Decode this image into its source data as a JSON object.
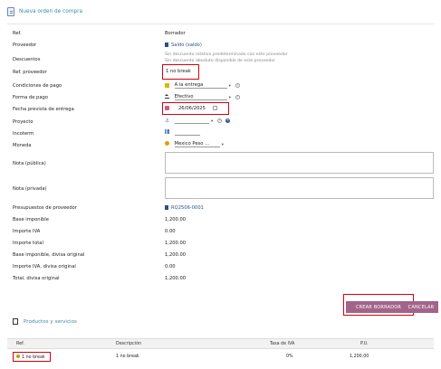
{
  "header": {
    "title": "Nueva orden de compra"
  },
  "form": {
    "ref": {
      "label": "Ref.",
      "value": "Borrador"
    },
    "proveedor": {
      "label": "Proveedor",
      "value": "Saldo (saldo)"
    },
    "descuentos": {
      "label": "Descuentos",
      "hint1": "Sin descuento relativo predeterminado con este proveedor",
      "hint2": "Sin descuento absoluto disponible de este proveedor"
    },
    "ref_proveedor": {
      "label": "Ref. proveedor",
      "value": "1 no break"
    },
    "condiciones": {
      "label": "Condiciones de pago",
      "value": "A la entrega"
    },
    "forma_pago": {
      "label": "Forma de pago",
      "value": "Efectivo"
    },
    "fecha": {
      "label": "Fecha prevista de entrega",
      "value": "26/06/2025"
    },
    "proyecto": {
      "label": "Proyecto",
      "value": ""
    },
    "incoterm": {
      "label": "Incoterm",
      "value": ""
    },
    "moneda": {
      "label": "Moneda",
      "value": "Mexico Peso ..."
    },
    "nota_publica": {
      "label": "Nota (pública)"
    },
    "nota_privada": {
      "label": "Nota (privada)"
    },
    "presupuestos": {
      "label": "Presupuestos de proveedor",
      "value": "RQ2506-0001"
    },
    "base_imponible": {
      "label": "Base imponible",
      "value": "1,200.00"
    },
    "importe_iva": {
      "label": "Importe IVA",
      "value": "0.00"
    },
    "importe_total": {
      "label": "Importe total",
      "value": "1,200.00"
    },
    "base_divisa": {
      "label": "Base imponible, divisa original",
      "value": "1,200.00"
    },
    "iva_divisa": {
      "label": "Importe IVA, divisa original",
      "value": "0.00"
    },
    "total_divisa": {
      "label": "Total, divisa original",
      "value": "1,200.00"
    }
  },
  "buttons": {
    "create": "CREAR BORRADOR",
    "cancel": "CANCELAR"
  },
  "products": {
    "title": "Productos y servicios",
    "headers": {
      "ref": "Ref.",
      "desc": "Descripción",
      "iva": "Tasa de IVA",
      "pu": "P.U."
    },
    "rows": [
      {
        "ref": "1 no break",
        "desc": "1 no break",
        "iva": "0%",
        "pu": "1,200.00"
      }
    ]
  },
  "colors": {
    "accent": "#3b8aa6",
    "button": "#a2648a",
    "highlight": "#d8000f"
  }
}
